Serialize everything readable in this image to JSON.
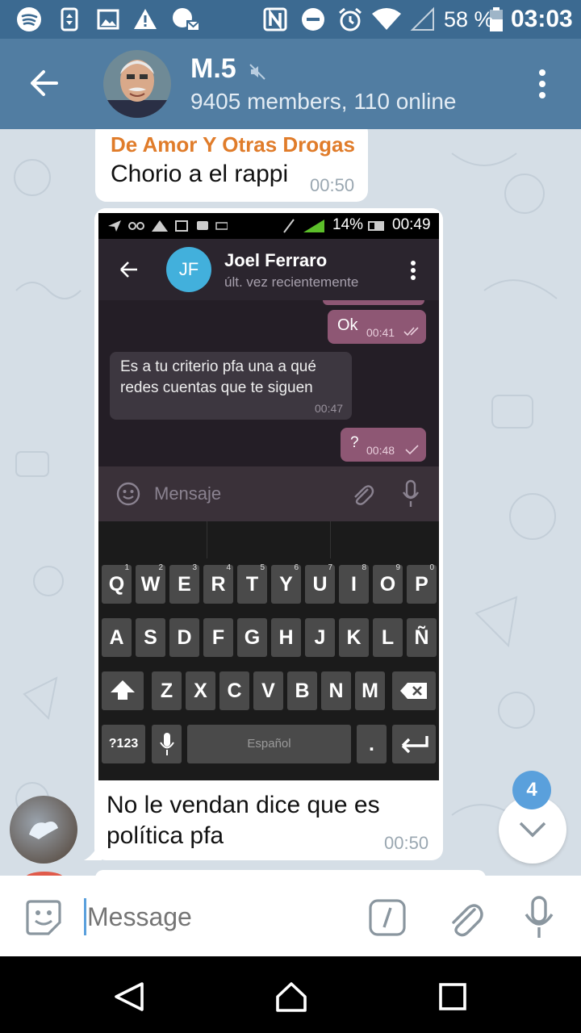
{
  "status_bar": {
    "battery_percent": "58 %",
    "time": "03:03",
    "icons": [
      "spotify-icon",
      "sim-transfer-icon",
      "gallery-icon",
      "alert-icon",
      "app-notification-icon",
      "nfc-icon",
      "do-not-disturb-icon",
      "alarm-icon",
      "wifi-icon",
      "signal-icon",
      "battery-icon"
    ]
  },
  "header": {
    "title": "M.5",
    "subtitle": "9405 members, 110 online",
    "back_icon": "back-arrow-icon",
    "mute_icon": "muted-icon",
    "menu_icon": "more-vert-icon"
  },
  "messages": [
    {
      "sender": "De Amor Y Otras Drogas",
      "text": "Chorio a el rappi",
      "time": "00:50"
    },
    {
      "caption_line1": "No le vendan dice que es",
      "caption_line2": "política pfa",
      "time": "00:50"
    }
  ],
  "embedded_screenshot": {
    "status": {
      "battery": "14%",
      "time": "00:49"
    },
    "contact_initials": "JF",
    "contact_name": "Joel Ferraro",
    "contact_status": "últ. vez recientemente",
    "messages": [
      {
        "text": "Ok",
        "time": "00:41",
        "outgoing": true
      },
      {
        "text_line1": "Es a tu criterio pfa una a qué",
        "text_line2": "redes cuentas que te siguen",
        "time": "00:47",
        "outgoing": false
      },
      {
        "text": "?",
        "time": "00:48",
        "outgoing": true
      }
    ],
    "input_placeholder": "Mensaje",
    "keyboard": {
      "row1": [
        "Q",
        "W",
        "E",
        "R",
        "T",
        "Y",
        "U",
        "I",
        "O",
        "P"
      ],
      "row1_nums": [
        "1",
        "2",
        "3",
        "4",
        "5",
        "6",
        "7",
        "8",
        "9",
        "0"
      ],
      "row2": [
        "A",
        "S",
        "D",
        "F",
        "G",
        "H",
        "J",
        "K",
        "L",
        "Ñ"
      ],
      "row3": [
        "Z",
        "X",
        "C",
        "V",
        "B",
        "N",
        "M"
      ],
      "sym_label": "?123",
      "space_label": "Español",
      "period": "."
    }
  },
  "unread_badge": "4",
  "input": {
    "placeholder": "Message"
  },
  "colors": {
    "header": "#517da2",
    "status_bar": "#3c6a91",
    "sender_name": "#e07c2a",
    "badge": "#5aa0dc",
    "chat_bg": "#d5dee6"
  }
}
